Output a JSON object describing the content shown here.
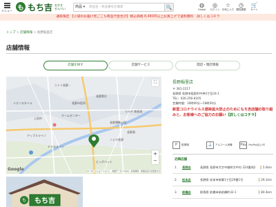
{
  "header": {
    "menu_label": "メニュー",
    "logo_mark": "も",
    "logo_name": "もち吉",
    "logo_sub_1": "おかき",
    "logo_sub_2": "せんべい",
    "search_scope": "商品",
    "search_placeholder": "商品名・商品番号を検索",
    "icons": [
      {
        "icon": "globe-icon",
        "label": "Global"
      },
      {
        "icon": "user-icon",
        "label": "ログイン"
      },
      {
        "icon": "star-icon",
        "label": "お気に入り"
      },
      {
        "icon": "history-icon",
        "label": "閲覧履歴"
      },
      {
        "icon": "cart-icon",
        "label": "カート"
      }
    ]
  },
  "banner": "通販限定 【小袋のお届け見ごこち商品代金合計】税込価格 8,480円以上お買上げで送料無料　詳しくはコチラ",
  "breadcrumb": {
    "home": "トップ",
    "sep1": " > ",
    "stores": "店舗情報",
    "sep2": " > ",
    "current": "長野稲里店"
  },
  "page_title": "店舗情報",
  "tabs": [
    {
      "label": "店舗を探す",
      "active": true
    },
    {
      "label": "店舗サービス",
      "active": false
    },
    {
      "label": "開店・閉店情報",
      "active": false
    }
  ],
  "map": {
    "labels": [
      "ニトリ長野...",
      "長野市役所",
      "長野県庁",
      "イオンスタイル",
      "上田市",
      "ツルヤ 南長池",
      "アップルライン",
      "長野運動公園",
      "ホームセンター",
      "長野東",
      "ノジマ長野",
      "ビッグハット",
      "テラスメイン"
    ],
    "fullscreen": "⛶",
    "zoom_in": "+",
    "zoom_out": "−",
    "google": "Google",
    "attribution": "キーボードショートカット　地図データ ©2021　利用規約　地図の誤りを報告する"
  },
  "photo_sign": "もち吉",
  "store": {
    "name": "長野稲里店",
    "zip": "〒 381-2217",
    "address": "長野県 長野市稲里町中央4丁目34-1",
    "tel": "TEL：026-256-6105",
    "hours": "営業時間：10時00分～18時30分",
    "alert": "新型コロナウイルス感染拡大防止のためにもち吉店舗の取り組みと、お客様へのご協力のお願い",
    "alert_link": "【詳しくはコチラ】"
  },
  "services": [
    {
      "icon": "parking-icon",
      "glyph": "P",
      "label": "駐車場"
    },
    {
      "icon": "alcohol-icon",
      "glyph": "🍶",
      "label": "アルコール消毒"
    },
    {
      "icon": "paypay-icon",
      "glyph": "Pay",
      "label": "PayPay払い可"
    }
  ],
  "nearby_heading": "近隣店舗",
  "nearby": [
    {
      "num": "1.",
      "name": "長野店",
      "pref": "長野県",
      "addr": "長野市大字中御所字中村 324番地2",
      "dist": "5.0km"
    },
    {
      "num": "2.",
      "name": "松本店",
      "pref": "長野県",
      "addr": "松本市筑摩1丁目29番1号",
      "dist": "29.1km"
    },
    {
      "num": "3.",
      "name": "前橋店",
      "pref": "群馬県",
      "addr": "前橋市新前橋町32-1",
      "dist": "80.4km"
    }
  ],
  "colors": {
    "brand_green": "#2e7d32",
    "alert_red": "#d32f2f",
    "banner_bg": "#fde9e0"
  }
}
